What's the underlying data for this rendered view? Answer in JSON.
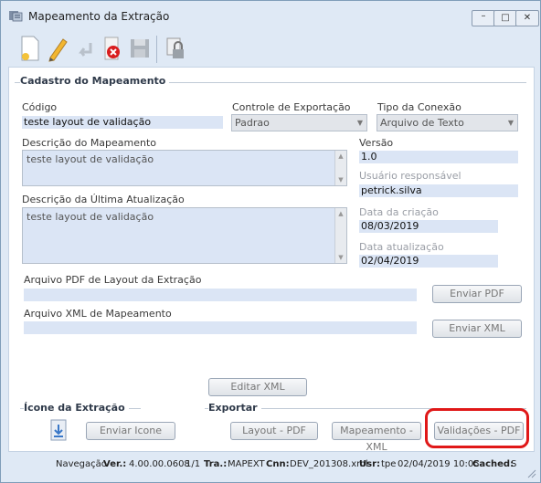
{
  "window": {
    "title": "Mapeamento da Extração",
    "controls": {
      "minimize": "–",
      "maximize": "□",
      "close": "✕"
    }
  },
  "toolbar": {
    "buttons": [
      {
        "name": "new",
        "icon": "new-document-icon"
      },
      {
        "name": "edit",
        "icon": "pencil-icon"
      },
      {
        "name": "undo",
        "icon": "undo-arrow-icon"
      },
      {
        "name": "delete",
        "icon": "delete-red-x-icon"
      },
      {
        "name": "save",
        "icon": "floppy-disk-icon"
      },
      {
        "name": "lock",
        "icon": "padlock-icon"
      }
    ]
  },
  "cadastro": {
    "title": "Cadastro do Mapeamento",
    "codigo_label": "Código",
    "codigo_value": "teste layout de validação",
    "controle_label": "Controle de Exportação",
    "controle_value": "Padrao",
    "tipo_label": "Tipo da Conexão",
    "tipo_value": "Arquivo de Texto",
    "descricao_label": "Descrição do Mapeamento",
    "descricao_value": "teste layout de validação",
    "versao_label": "Versão",
    "versao_value": "1.0",
    "usuario_label": "Usuário responsável",
    "usuario_value": "petrick.silva",
    "ultima_label": "Descrição da Última Atualização",
    "ultima_value": "teste layout de validação",
    "criacao_label": "Data da criação",
    "criacao_value": "08/03/2019",
    "atualizacao_label": "Data atualização",
    "atualizacao_value": "02/04/2019",
    "pdf_label": "Arquivo PDF de Layout da Extração",
    "pdf_value": "",
    "enviar_pdf": "Enviar PDF",
    "xml_label": "Arquivo XML de Mapeamento",
    "xml_value": "",
    "enviar_xml": "Enviar XML",
    "editar_xml": "Editar XML"
  },
  "icone": {
    "title": "Ícone da Extração",
    "enviar_icone": "Enviar Icone"
  },
  "exportar": {
    "title": "Exportar",
    "layout_pdf": "Layout - PDF",
    "mapeamento_xml": "Mapeamento - XML",
    "validacoes_pdf": "Validações - PDF"
  },
  "status": {
    "nav": "Navegação",
    "ver_label": "Ver.:",
    "ver_value": "4.00.00.0608",
    "page": "1/1",
    "tra_label": "Tra.:",
    "tra_value": "MAPEXT",
    "cnn_label": "Cnn:",
    "cnn_value": "DEV_201308.xml",
    "usr_label": "Usr:",
    "usr_value": "tpe",
    "datetime": "02/04/2019 10:05",
    "cached_label": "Cached:",
    "cached_value": "S"
  },
  "colors": {
    "highlight": "#e01818",
    "field_bg": "#dbe5f5",
    "window_bg": "#dfe9f5"
  }
}
